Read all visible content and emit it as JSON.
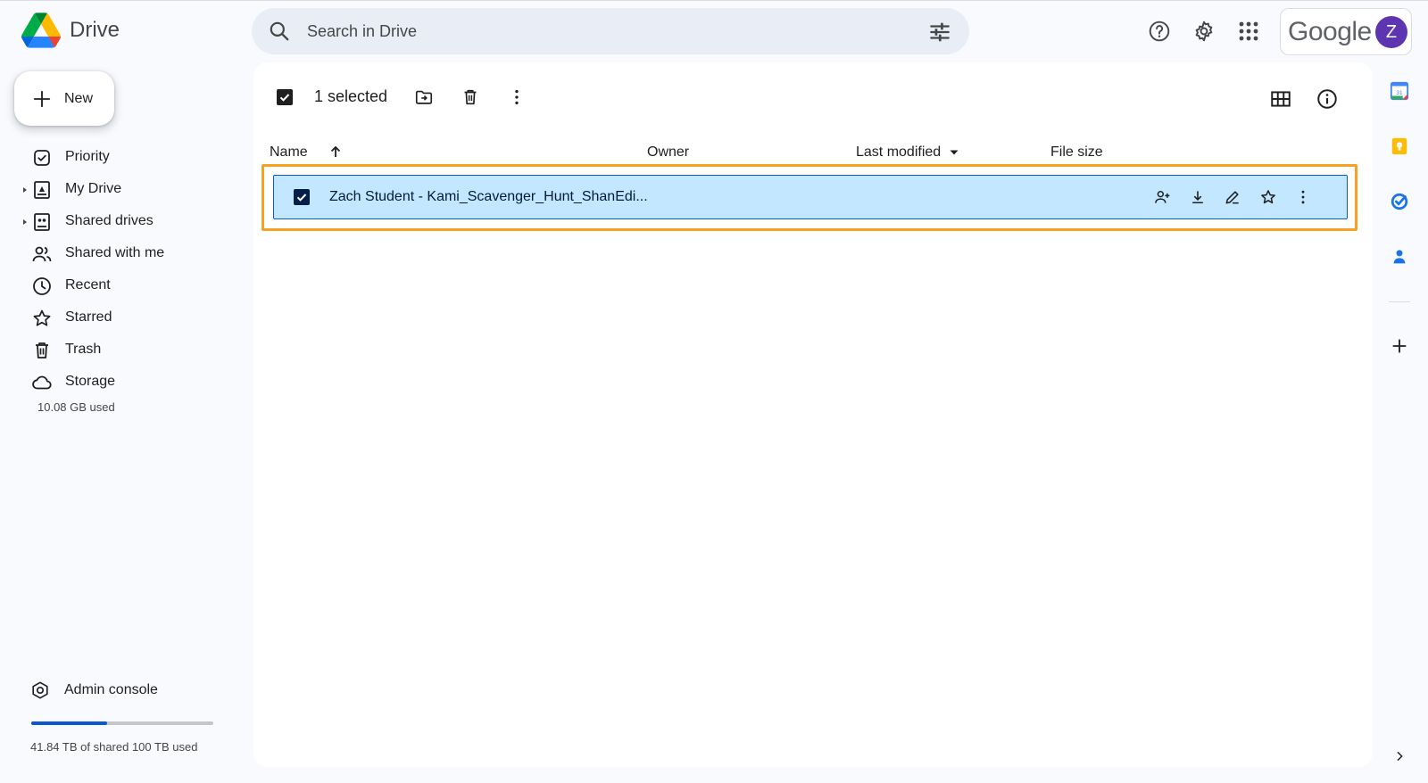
{
  "app": {
    "name": "Drive"
  },
  "search": {
    "placeholder": "Search in Drive",
    "value": ""
  },
  "header": {
    "icons": [
      "help-icon",
      "settings-icon",
      "apps-grid-icon"
    ],
    "account": {
      "brand": "Google",
      "avatar_initial": "Z",
      "avatar_color": "#5e35b1"
    }
  },
  "new_button": {
    "label": "New"
  },
  "sidebar": {
    "items": [
      {
        "label": "Priority",
        "icon": "priority-icon",
        "expandable": false
      },
      {
        "label": "My Drive",
        "icon": "my-drive-icon",
        "expandable": true
      },
      {
        "label": "Shared drives",
        "icon": "shared-drives-icon",
        "expandable": true
      },
      {
        "label": "Shared with me",
        "icon": "shared-with-me-icon",
        "expandable": false
      },
      {
        "label": "Recent",
        "icon": "clock-icon",
        "expandable": false
      },
      {
        "label": "Starred",
        "icon": "star-icon",
        "expandable": false
      },
      {
        "label": "Trash",
        "icon": "trash-icon",
        "expandable": false
      },
      {
        "label": "Storage",
        "icon": "cloud-icon",
        "expandable": false
      }
    ],
    "storage_used": "10.08 GB used",
    "admin_console": "Admin console",
    "quota": {
      "text": "41.84 TB of shared 100 TB used",
      "fraction": 0.4184
    }
  },
  "toolbar": {
    "selected_text": "1 selected"
  },
  "columns": {
    "name": "Name",
    "owner": "Owner",
    "last_modified": "Last modified",
    "file_size": "File size"
  },
  "files": [
    {
      "name": "Zach Student - Kami_Scavenger_Hunt_ShanEdi...",
      "selected": true
    }
  ],
  "colors": {
    "accent": "#0b57d0",
    "row_selected": "#c2e7ff",
    "highlight": "#f4a124"
  }
}
